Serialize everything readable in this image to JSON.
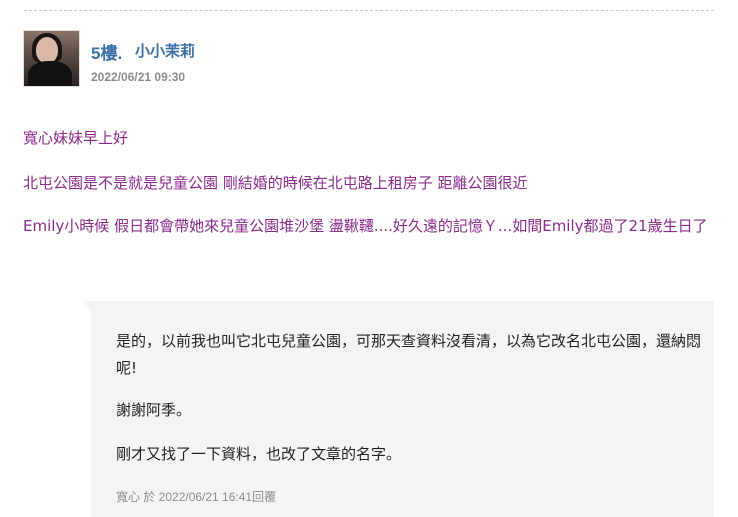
{
  "post": {
    "floor": "5樓.",
    "author": "小小茉莉",
    "date": "2022/06/21 09:30",
    "avatar_icon": "profile-photo-avatar",
    "paragraphs": [
      "寬心妹妹早上好",
      "北屯公園是不是就是兒童公園 剛結婚的時候在北屯路上租房子 距離公園很近",
      "Emily小時候 假日都會帶她來兒童公園堆沙堡 盪鞦韆....好久遠的記憶Ｙ...如間Emily都過了21歲生日了"
    ]
  },
  "reply": {
    "paragraphs": [
      "是的，以前我也叫它北屯兒童公園，可那天查資料沒看清，以為它改名北屯公園，還納悶呢!",
      "謝謝阿季。",
      "剛才又找了一下資料，也改了文章的名字。"
    ],
    "meta": "寬心 於 2022/06/21 16:41回覆"
  },
  "colors": {
    "author_blue": "#3d6fa8",
    "message_purple": "#8b2c8b",
    "reply_bg": "#f4f4f4",
    "meta_gray": "#8c8c8c"
  }
}
